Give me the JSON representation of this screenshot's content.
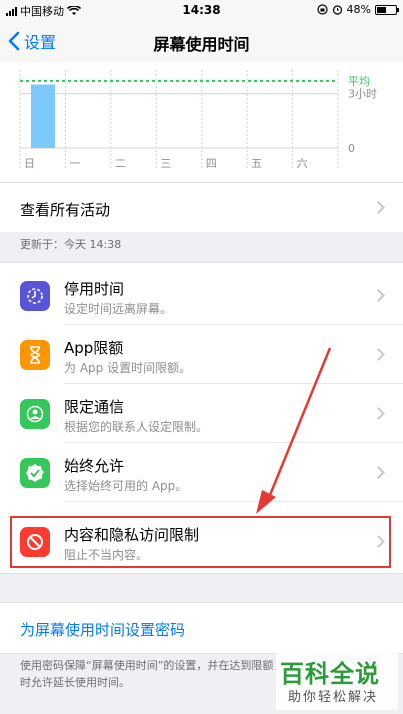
{
  "status_bar": {
    "carrier": "中国移动",
    "time": "14:38",
    "battery": "48%"
  },
  "nav": {
    "back_label": "设置",
    "title": "屏幕使用时间"
  },
  "chart_data": {
    "type": "bar",
    "categories": [
      "日",
      "一",
      "二",
      "三",
      "四",
      "五",
      "六"
    ],
    "values": [
      3.5,
      0,
      0,
      0,
      0,
      0,
      0
    ],
    "ylim": [
      0,
      4.3
    ],
    "y_tick_labels": [
      "3小时",
      "0"
    ],
    "y_ticks": [
      3,
      0
    ],
    "average_label": "平均",
    "average_value": 3.7,
    "colors": {
      "bar": "#7cc8f8",
      "average": "#34c759",
      "grid": "#d1d1d6"
    }
  },
  "see_all": {
    "label": "查看所有活动"
  },
  "updated": {
    "text": "更新于：今天 14:38"
  },
  "items": [
    {
      "title": "停用时间",
      "subtitle": "设定时间远离屏幕。",
      "icon": "downtime-icon",
      "color": "#5856d6"
    },
    {
      "title": "App限额",
      "subtitle": "为 App 设置时间限额。",
      "icon": "hourglass-icon",
      "color": "#ff9500"
    },
    {
      "title": "限定通信",
      "subtitle": "根据您的联系人设定限制。",
      "icon": "contact-icon",
      "color": "#34c759"
    },
    {
      "title": "始终允许",
      "subtitle": "选择始终可用的 App。",
      "icon": "checkmark-badge-icon",
      "color": "#34c759"
    },
    {
      "title": "内容和隐私访问限制",
      "subtitle": "阻止不当内容。",
      "icon": "restriction-icon",
      "color": "#ff3b30"
    }
  ],
  "passcode": {
    "label": "为屏幕使用时间设置密码"
  },
  "footer": {
    "note": "使用密码保障“屏幕使用时间”的设置，并在达到限额时允许延长使用时间。"
  },
  "watermark": {
    "title": "百科全说",
    "subtitle": "助你轻松解决"
  }
}
